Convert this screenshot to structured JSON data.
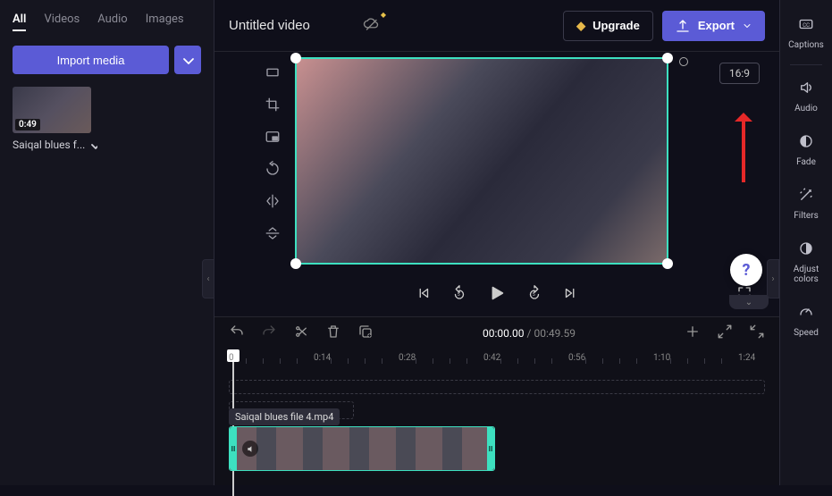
{
  "media_panel": {
    "tabs": [
      "All",
      "Videos",
      "Audio",
      "Images"
    ],
    "active_tab": "All",
    "import_label": "Import media",
    "clip": {
      "duration": "0:49",
      "name": "Saiqal blues f..."
    }
  },
  "header": {
    "title": "Untitled video",
    "upgrade_label": "Upgrade",
    "export_label": "Export"
  },
  "preview": {
    "aspect_ratio": "16:9"
  },
  "playbar": {
    "current": "00:00.00",
    "total": "00:49.59"
  },
  "timeline": {
    "ticks": [
      "0",
      "0:14",
      "0:28",
      "0:42",
      "0:56",
      "1:10",
      "1:24"
    ],
    "tooltip": "Saiqal blues file 4.mp4"
  },
  "right_sidebar": {
    "items": [
      {
        "id": "captions-tool",
        "label": "Captions"
      },
      {
        "id": "audio-tool",
        "label": "Audio"
      },
      {
        "id": "fade-tool",
        "label": "Fade"
      },
      {
        "id": "filters-tool",
        "label": "Filters"
      },
      {
        "id": "adjust-colors-tool",
        "label": "Adjust colors"
      },
      {
        "id": "speed-tool",
        "label": "Speed"
      }
    ]
  }
}
